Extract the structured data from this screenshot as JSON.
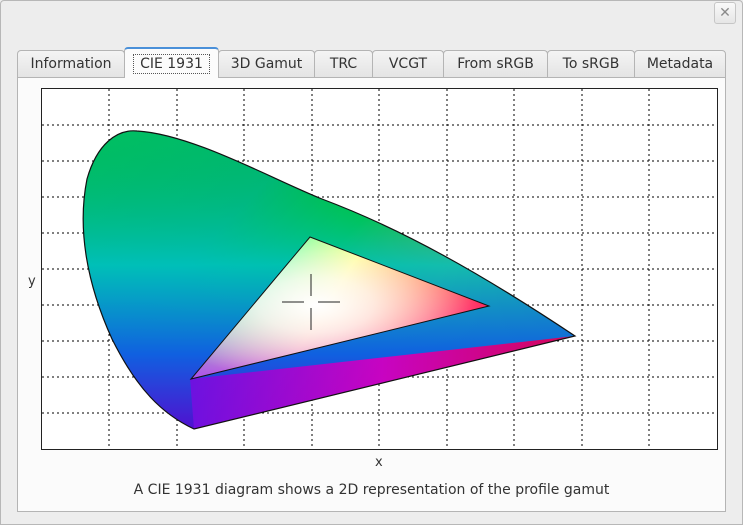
{
  "window": {
    "close_icon": "close-icon"
  },
  "tabs": [
    {
      "label": "Information"
    },
    {
      "label": "CIE 1931",
      "active": true
    },
    {
      "label": "3D Gamut"
    },
    {
      "label": "TRC"
    },
    {
      "label": "VCGT"
    },
    {
      "label": "From sRGB"
    },
    {
      "label": "To sRGB"
    },
    {
      "label": "Metadata"
    }
  ],
  "plot": {
    "xlabel": "x",
    "ylabel": "y",
    "grid": true,
    "caption": "A CIE 1931 diagram shows a 2D representation of the profile gamut"
  }
}
